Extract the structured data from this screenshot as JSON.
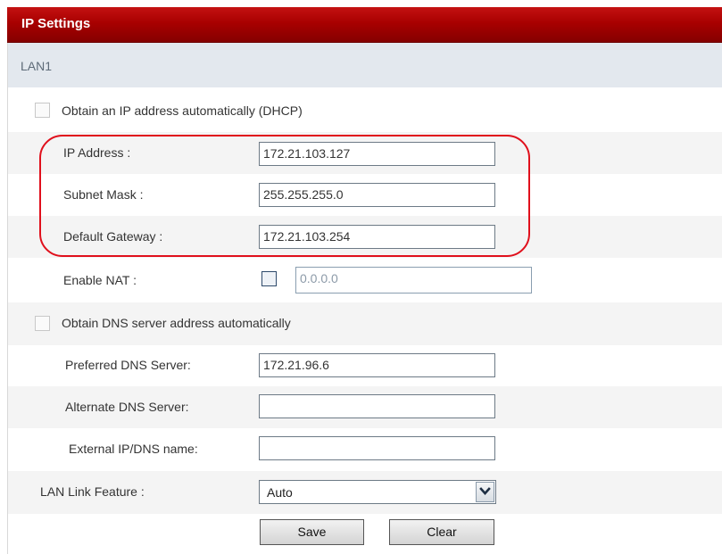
{
  "window": {
    "title": "IP Settings"
  },
  "section": {
    "title": "LAN1"
  },
  "dhcp": {
    "label": "Obtain an IP address automatically (DHCP)",
    "checked": false
  },
  "ip_address": {
    "label": "IP Address :",
    "value": "172.21.103.127"
  },
  "subnet_mask": {
    "label": "Subnet Mask :",
    "value": "255.255.255.0"
  },
  "default_gateway": {
    "label": "Default Gateway :",
    "value": "172.21.103.254"
  },
  "nat": {
    "label": "Enable NAT :",
    "checked": false,
    "value": "0.0.0.0"
  },
  "dns_auto": {
    "label": "Obtain DNS server address automatically",
    "checked": false
  },
  "preferred_dns": {
    "label": "Preferred DNS Server:",
    "value": "172.21.96.6"
  },
  "alternate_dns": {
    "label": "Alternate DNS Server:",
    "value": ""
  },
  "external_ip": {
    "label": "External IP/DNS name:",
    "value": ""
  },
  "lan_link": {
    "label": "LAN Link Feature :",
    "selected": "Auto"
  },
  "buttons": {
    "save": "Save",
    "clear": "Clear"
  },
  "colors": {
    "title_bar": "#a80000",
    "section_header": "#e3e8ee",
    "highlight": "#e0101c"
  },
  "icons": {
    "select_arrow": "chevron-down-icon"
  }
}
